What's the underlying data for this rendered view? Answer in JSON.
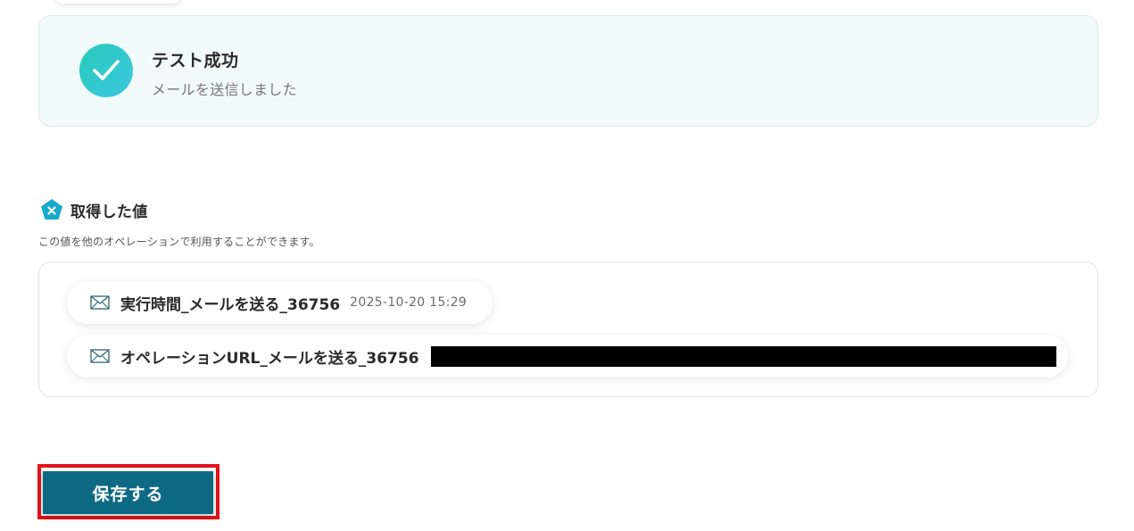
{
  "colors": {
    "accent": "#0e6a82",
    "success_gradient_start": "#27cbb9",
    "success_gradient_end": "#3cc7e0",
    "highlight": "#e3141b",
    "card_bg": "#f1fafa"
  },
  "test_result": {
    "icon": "check-circle-icon",
    "title": "テスト成功",
    "message": "メールを送信しました"
  },
  "retrieved_values": {
    "icon": "pentagon-x-badge-icon",
    "title": "取得した値",
    "description": "この値を他のオペレーションで利用することができます。",
    "items": [
      {
        "icon": "mail-icon",
        "label": "実行時間_メールを送る_36756",
        "value": "2025-10-20 15:29"
      },
      {
        "icon": "mail-icon",
        "label": "オペレーションURL_メールを送る_36756",
        "value_redacted": true
      }
    ]
  },
  "actions": {
    "save_label": "保存する"
  }
}
